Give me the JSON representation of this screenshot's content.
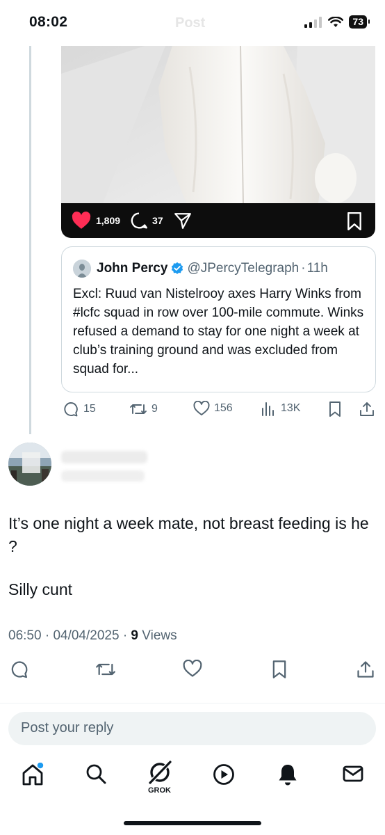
{
  "status_bar": {
    "time": "08:02",
    "ghost_title": "Post",
    "battery": "73"
  },
  "media_bar": {
    "likes": "1,809",
    "comments": "37"
  },
  "quoted_post": {
    "name": "John Percy",
    "handle": "@JPercyTelegraph",
    "age": "11h",
    "text": "Excl: Ruud van Nistelrooy axes Harry Winks from #lcfc squad in row over 100-mile commute. Winks refused a demand to stay for one night a week at club’s training ground and was excluded from squad for..."
  },
  "parent_actions": {
    "replies": "15",
    "reposts": "9",
    "likes": "156",
    "views": "13K"
  },
  "reply": {
    "text_line1": "It’s one night a week mate, not breast feeding is he ?",
    "text_line2": "Silly cunt",
    "time": "06:50",
    "date": "04/04/2025",
    "views_count": "9",
    "views_label": "Views"
  },
  "composer": {
    "placeholder": "Post your reply"
  },
  "tabbar": {
    "grok_label": "GROK"
  },
  "colors": {
    "accent": "#1d9bf0",
    "like_red": "#ff2d55",
    "muted": "#536471"
  }
}
